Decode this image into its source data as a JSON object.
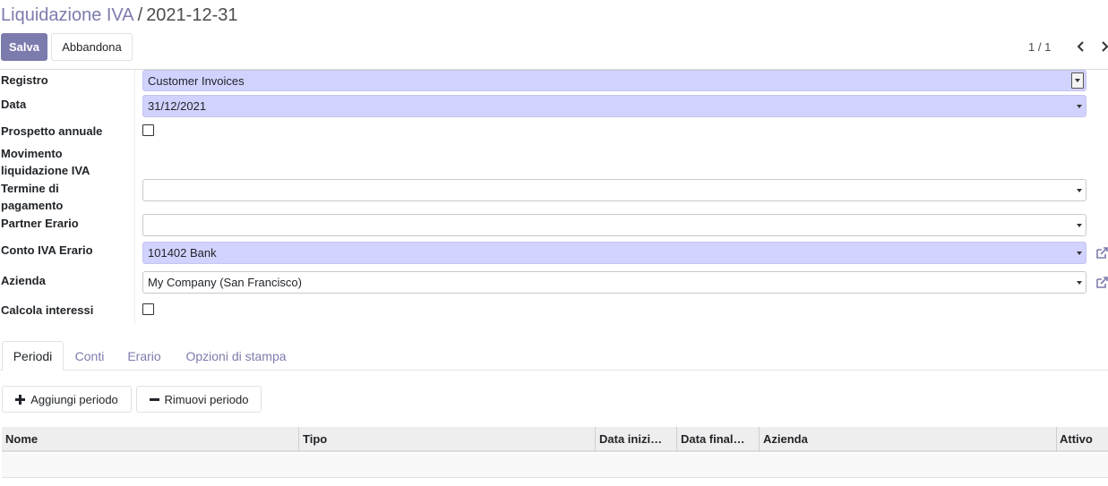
{
  "breadcrumb": {
    "parent": "Liquidazione IVA",
    "separator": "/",
    "current": "2021-12-31"
  },
  "toolbar": {
    "save_label": "Salva",
    "discard_label": "Abbandona"
  },
  "pager": {
    "value": "1 / 1"
  },
  "form": {
    "registro": {
      "label": "Registro",
      "value": "Customer Invoices"
    },
    "data": {
      "label": "Data",
      "value": "31/12/2021"
    },
    "prospetto": {
      "label": "Prospetto annuale",
      "checked": false
    },
    "movimento": {
      "label_line1": "Movimento",
      "label_line2": "liquidazione IVA"
    },
    "termine": {
      "label_line1": "Termine di",
      "label_line2": "pagamento",
      "value": ""
    },
    "partner": {
      "label": "Partner Erario",
      "value": ""
    },
    "conto": {
      "label": "Conto IVA Erario",
      "value": "101402 Bank"
    },
    "azienda": {
      "label": "Azienda",
      "value": "My Company (San Francisco)"
    },
    "calcola": {
      "label": "Calcola interessi",
      "checked": false
    }
  },
  "tabs": [
    {
      "label": "Periodi",
      "active": true
    },
    {
      "label": "Conti",
      "active": false
    },
    {
      "label": "Erario",
      "active": false
    },
    {
      "label": "Opzioni di stampa",
      "active": false
    }
  ],
  "periods": {
    "add_label": "Aggiungi periodo",
    "remove_label": "Rimuovi periodo",
    "columns": [
      "Nome",
      "Tipo",
      "Data inizi…",
      "Data final…",
      "Azienda",
      "Attivo"
    ],
    "rows": []
  },
  "colors": {
    "accent": "#7c7bad",
    "required_bg": "#d2d2ff"
  }
}
